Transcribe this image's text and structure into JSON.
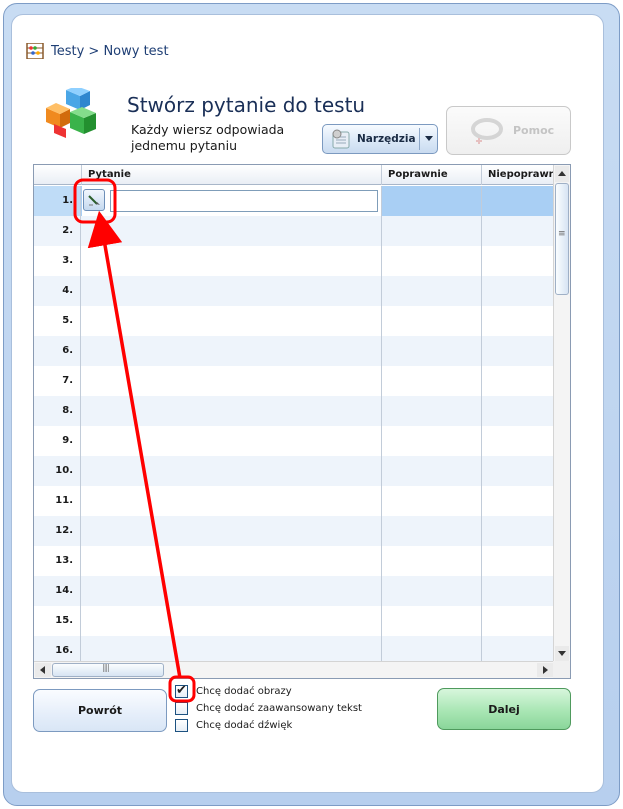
{
  "breadcrumb": "Testy > Nowy test",
  "header": {
    "title": "Stwórz pytanie do testu",
    "subtitle": "Każdy wiersz odpowiada jednemu pytaniu",
    "tools_label": "Narzędzia",
    "help_label": "Pomoc"
  },
  "grid": {
    "columns": [
      "Pytanie",
      "Poprawnie",
      "Niepoprawnie"
    ],
    "rows": [
      "1.",
      "2.",
      "3.",
      "4.",
      "5.",
      "6.",
      "7.",
      "8.",
      "9.",
      "10.",
      "11.",
      "12.",
      "13.",
      "14.",
      "15.",
      "16."
    ],
    "selected_row": 1,
    "input_value": ""
  },
  "footer": {
    "back_label": "Powrót",
    "next_label": "Dalej",
    "options": [
      {
        "label": "Chcę dodać obrazy",
        "checked": true
      },
      {
        "label": "Chcę dodać zaawansowany tekst",
        "checked": false
      },
      {
        "label": "Chcę dodać dźwięk",
        "checked": false
      }
    ]
  },
  "colors": {
    "selected_row": "#a9cff4",
    "next_button": "#a9e6b4",
    "annotation": "#ff0000"
  },
  "icons": [
    "abacus-icon",
    "cubes-logo-icon",
    "tools-icon",
    "help-lifebuoy-icon",
    "edit-image-icon"
  ]
}
